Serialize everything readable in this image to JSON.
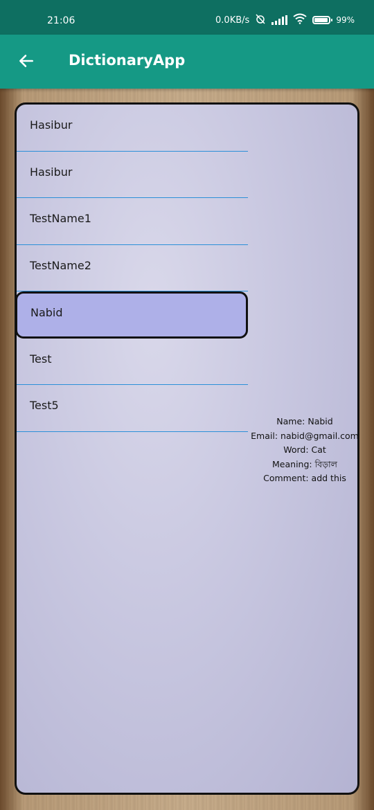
{
  "status_bar": {
    "time": "21:06",
    "speed": "0.0KB/s",
    "battery": "99"
  },
  "app_bar": {
    "title": "DictionaryApp",
    "back_icon": "arrow-left-icon"
  },
  "list": {
    "items": [
      {
        "label": "Hasibur"
      },
      {
        "label": "Hasibur"
      },
      {
        "label": "TestName1"
      },
      {
        "label": "TestName2"
      },
      {
        "label": "Nabid"
      },
      {
        "label": "Test"
      },
      {
        "label": "Test5"
      }
    ]
  },
  "details": {
    "name": "Name: Nabid",
    "email": "Email: nabid@gmail.com",
    "word": "Word: Cat",
    "meaning": "Meaning: বিড়াল",
    "comment": "Comment: add this"
  },
  "colors": {
    "status_bar": "#0e6f61",
    "app_bar": "#159985",
    "divider": "#2a8fd8",
    "selected_item": "#aeb0e8",
    "card": "#c8c7e0"
  }
}
